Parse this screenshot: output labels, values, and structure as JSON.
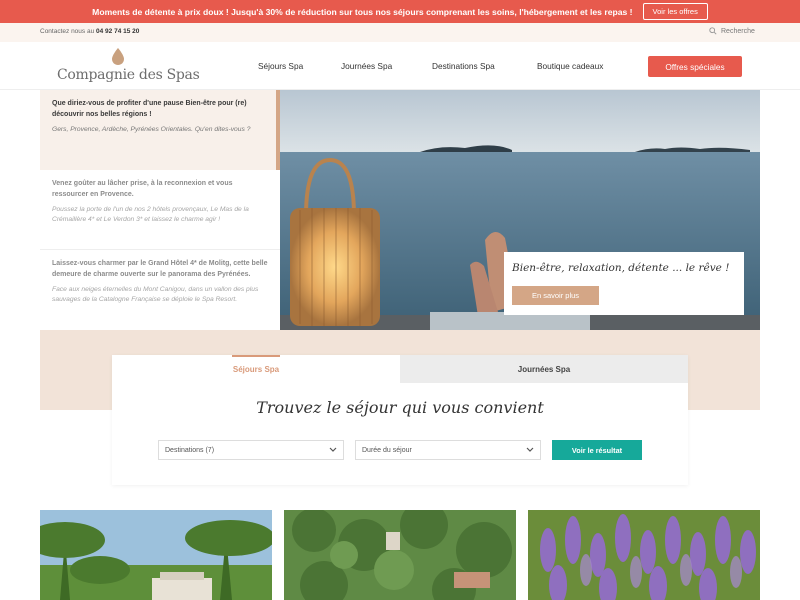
{
  "promo": {
    "text": "Moments de détente à prix doux ! Jusqu'à 30% de réduction sur tous nos séjours comprenant les soins, l'hébergement et les repas !",
    "button": "Voir les offres"
  },
  "utility": {
    "contact_label": "Contactez nous au",
    "phone": "04 92 74 15 20",
    "search_label": "Recherche"
  },
  "logo": {
    "text": "Compagnie des Spas"
  },
  "nav": {
    "items": [
      {
        "label": "Séjours Spa"
      },
      {
        "label": "Journées Spa"
      },
      {
        "label": "Destinations Spa"
      },
      {
        "label": "Boutique cadeaux"
      }
    ],
    "offers_button": "Offres spéciales"
  },
  "hero": {
    "stories": [
      {
        "title": "Que diriez-vous de profiter d'une pause Bien-être pour (re) découvrir nos belles régions !",
        "desc": "Gers, Provence, Ardèche, Pyrénées Orientales. Qu'en dites-vous ?"
      },
      {
        "title": "Venez goûter au lâcher prise, à la reconnexion et vous ressourcer en Provence.",
        "desc": "Poussez la porte de l'un de nos 2 hôtels provençaux, Le Mas de la Crémaillère 4* et Le Verdon 3* et laissez le charme agir !"
      },
      {
        "title": "Laissez-vous charmer par le Grand Hôtel 4* de Molitg, cette belle demeure de charme ouverte sur le panorama des Pyrénées.",
        "desc": "Face aux neiges éternelles du Mont Canigou, dans un vallon des plus sauvages de la Catalogne Française se déploie le Spa Resort."
      }
    ],
    "card_title": "Bien-être, relaxation, détente ... le rêve !",
    "card_button": "En savoir plus"
  },
  "search_panel": {
    "tabs": [
      {
        "label": "Séjours Spa",
        "active": true
      },
      {
        "label": "Journées Spa",
        "active": false
      }
    ],
    "title": "Trouvez le séjour qui vous convient",
    "destinations": "Destinations (7)",
    "duration": "Durée du séjour",
    "result_button": "Voir le résultat"
  },
  "colors": {
    "promo": "#e75a4d",
    "accent": "#d4a686",
    "teal": "#16a99a",
    "band": "#f2e3d8"
  }
}
